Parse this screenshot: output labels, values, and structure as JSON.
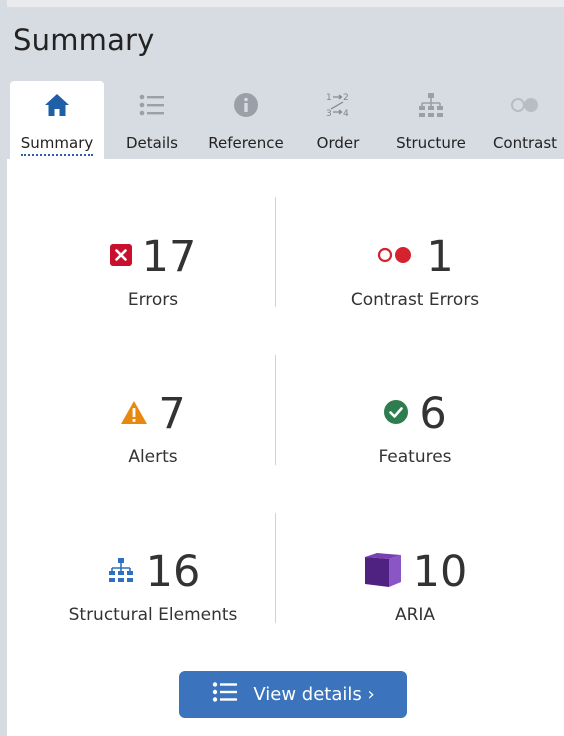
{
  "header": {
    "title": "Summary"
  },
  "tabs": [
    {
      "label": "Summary",
      "icon": "home-icon",
      "active": true
    },
    {
      "label": "Details",
      "icon": "list-icon",
      "active": false
    },
    {
      "label": "Reference",
      "icon": "info-icon",
      "active": false
    },
    {
      "label": "Order",
      "icon": "order-icon",
      "active": false
    },
    {
      "label": "Structure",
      "icon": "hierarchy-icon",
      "active": false
    },
    {
      "label": "Contrast",
      "icon": "contrast-icon",
      "active": false
    }
  ],
  "stats": {
    "errors": {
      "value": "17",
      "label": "Errors",
      "icon": "error-x-icon",
      "color": "#c8102e"
    },
    "contrast_errors": {
      "value": "1",
      "label": "Contrast Errors",
      "icon": "contrast-icon",
      "color": "#d4232f"
    },
    "alerts": {
      "value": "7",
      "label": "Alerts",
      "icon": "alert-triangle-icon",
      "color": "#e8880f"
    },
    "features": {
      "value": "6",
      "label": "Features",
      "icon": "check-circle-icon",
      "color": "#2e7d4f"
    },
    "structural": {
      "value": "16",
      "label": "Structural Elements",
      "icon": "hierarchy-icon",
      "color": "#2f6fbf"
    },
    "aria": {
      "value": "10",
      "label": "ARIA",
      "icon": "aria-cube-icon",
      "color": "#5b2a8c"
    }
  },
  "button": {
    "label": "View details ›",
    "icon": "list-icon"
  }
}
